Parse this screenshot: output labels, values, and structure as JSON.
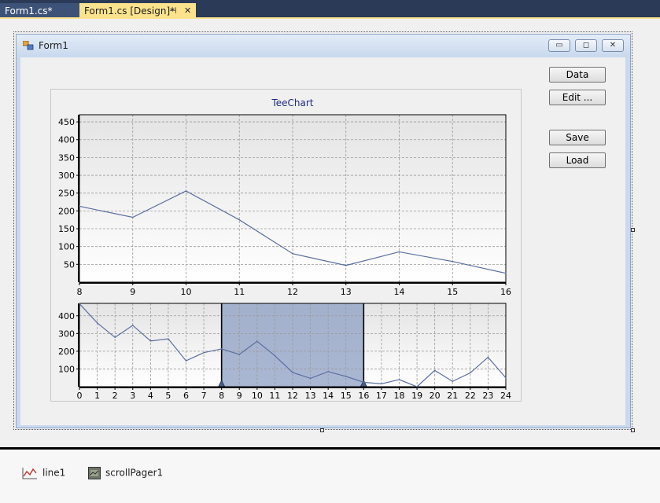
{
  "tabs": [
    {
      "label": "Form1.cs*",
      "active": false
    },
    {
      "label": "Form1.cs [Design]*",
      "active": true
    }
  ],
  "tab_pin_glyph": "⊣",
  "tab_close_glyph": "✕",
  "form": {
    "title": "Form1"
  },
  "window_buttons": {
    "minimize": "▭",
    "maximize": "◻",
    "close": "✕"
  },
  "buttons": {
    "data": "Data",
    "edit": "Edit ...",
    "save": "Save",
    "load": "Load"
  },
  "tray": {
    "line_label": "line1",
    "pager_label": "scrollPager1"
  },
  "colors": {
    "series": "#5a6f9e",
    "pager_highlight": "#8d9fc4"
  },
  "chart_data": [
    {
      "type": "line",
      "title": "TeeChart",
      "x": [
        8,
        9,
        10,
        11,
        12,
        13,
        14,
        15,
        16
      ],
      "series": [
        {
          "values": [
            213,
            182,
            256,
            175,
            80,
            47,
            85,
            58,
            25
          ]
        }
      ],
      "xlim": [
        8,
        16
      ],
      "ylim": [
        0,
        470
      ],
      "xticks": [
        8,
        9,
        10,
        11,
        12,
        13,
        14,
        15,
        16
      ],
      "yticks": [
        50,
        100,
        150,
        200,
        250,
        300,
        350,
        400,
        450
      ],
      "grid": true
    },
    {
      "type": "line",
      "x": [
        0,
        1,
        2,
        3,
        4,
        5,
        6,
        7,
        8,
        9,
        10,
        11,
        12,
        13,
        14,
        15,
        16,
        17,
        18,
        19,
        20,
        21,
        22,
        23,
        24
      ],
      "series": [
        {
          "values": [
            468,
            360,
            278,
            346,
            258,
            270,
            146,
            192,
            213,
            182,
            256,
            175,
            80,
            47,
            85,
            58,
            25,
            16,
            40,
            0,
            92,
            30,
            78,
            166,
            50
          ]
        }
      ],
      "xlim": [
        0,
        24
      ],
      "ylim": [
        0,
        470
      ],
      "xticks": [
        0,
        1,
        2,
        3,
        4,
        5,
        6,
        7,
        8,
        9,
        10,
        11,
        12,
        13,
        14,
        15,
        16,
        17,
        18,
        19,
        20,
        21,
        22,
        23,
        24
      ],
      "yticks": [
        100,
        200,
        300,
        400
      ],
      "grid": true,
      "selection": [
        8,
        16
      ]
    }
  ]
}
